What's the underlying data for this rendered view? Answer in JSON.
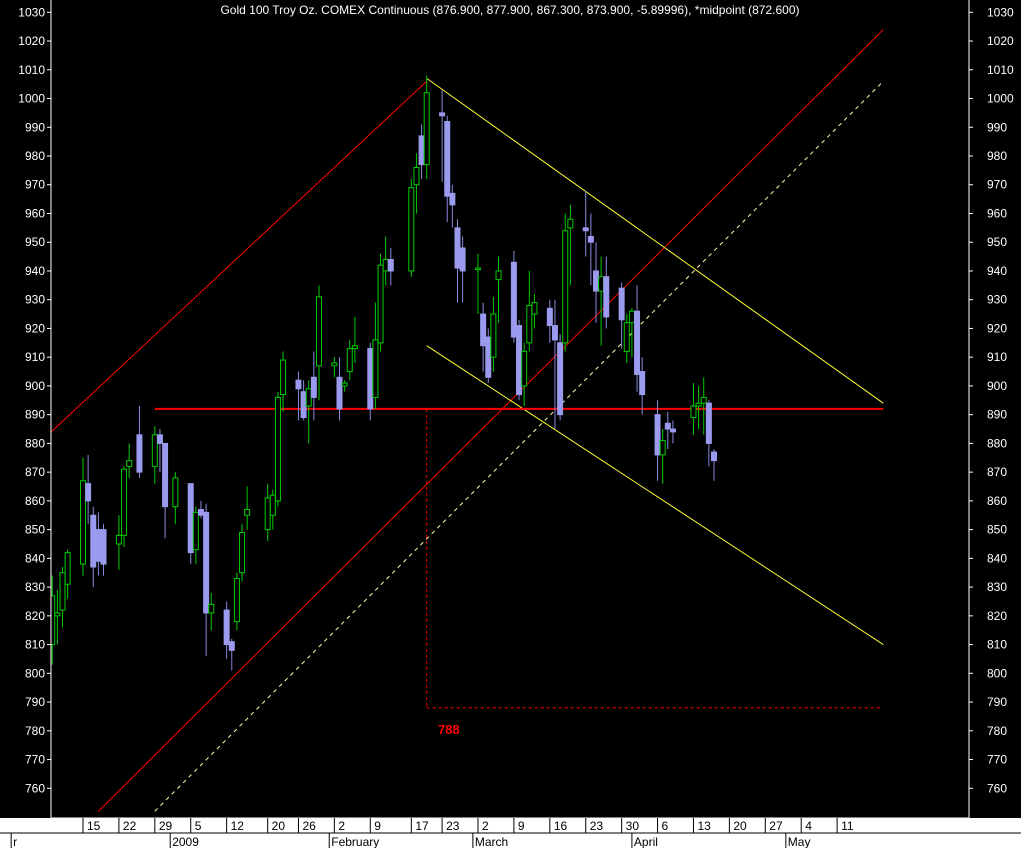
{
  "chart_data": {
    "type": "candlestick",
    "title": "Gold 100 Troy Oz. COMEX Continuous (876.900, 877.900, 867.300, 873.900, -5.89996), *midpoint (872.600)",
    "ylim": [
      752,
      1033
    ],
    "y_ticks": [
      760,
      770,
      780,
      790,
      800,
      810,
      820,
      830,
      840,
      850,
      860,
      870,
      880,
      890,
      900,
      910,
      920,
      930,
      940,
      950,
      960,
      970,
      980,
      990,
      1000,
      1010,
      1020,
      1030
    ],
    "x_day_ticks": [
      {
        "label": "15",
        "date": "2008-12-15"
      },
      {
        "label": "22",
        "date": "2008-12-22"
      },
      {
        "label": "29",
        "date": "2008-12-29"
      },
      {
        "label": "5",
        "date": "2009-01-05"
      },
      {
        "label": "12",
        "date": "2009-01-12"
      },
      {
        "label": "20",
        "date": "2009-01-20"
      },
      {
        "label": "26",
        "date": "2009-01-26"
      },
      {
        "label": "2",
        "date": "2009-02-02"
      },
      {
        "label": "9",
        "date": "2009-02-09"
      },
      {
        "label": "17",
        "date": "2009-02-17"
      },
      {
        "label": "23",
        "date": "2009-02-23"
      },
      {
        "label": "2",
        "date": "2009-03-02"
      },
      {
        "label": "9",
        "date": "2009-03-09"
      },
      {
        "label": "16",
        "date": "2009-03-16"
      },
      {
        "label": "23",
        "date": "2009-03-23"
      },
      {
        "label": "30",
        "date": "2009-03-30"
      },
      {
        "label": "6",
        "date": "2009-04-06"
      },
      {
        "label": "13",
        "date": "2009-04-13"
      },
      {
        "label": "20",
        "date": "2009-04-20"
      },
      {
        "label": "27",
        "date": "2009-04-27"
      },
      {
        "label": "4",
        "date": "2009-05-04"
      },
      {
        "label": "11",
        "date": "2009-05-11"
      }
    ],
    "x_month_labels": [
      {
        "label": "r",
        "date": "2008-12-01"
      },
      {
        "label": "2009",
        "date": "2009-01-01"
      },
      {
        "label": "February",
        "date": "2009-02-01"
      },
      {
        "label": "March",
        "date": "2009-03-01"
      },
      {
        "label": "April",
        "date": "2009-04-01"
      },
      {
        "label": "May",
        "date": "2009-05-01"
      }
    ],
    "candles": [
      {
        "date": "2008-12-08",
        "open": 776,
        "high": 800,
        "low": 775,
        "close": 798
      },
      {
        "date": "2008-12-09",
        "open": 810,
        "high": 834,
        "low": 803,
        "close": 827
      },
      {
        "date": "2008-12-10",
        "open": 820,
        "high": 829,
        "low": 810,
        "close": 821
      },
      {
        "date": "2008-12-11",
        "open": 822,
        "high": 837,
        "low": 816,
        "close": 835
      },
      {
        "date": "2008-12-12",
        "open": 831,
        "high": 843,
        "low": 826,
        "close": 842
      },
      {
        "date": "2008-12-15",
        "open": 838,
        "high": 875,
        "low": 834,
        "close": 867
      },
      {
        "date": "2008-12-16",
        "open": 866,
        "high": 876,
        "low": 852,
        "close": 860
      },
      {
        "date": "2008-12-17",
        "open": 855,
        "high": 858,
        "low": 830,
        "close": 837
      },
      {
        "date": "2008-12-18",
        "open": 850,
        "high": 856,
        "low": 834,
        "close": 839
      },
      {
        "date": "2008-12-19",
        "open": 850,
        "high": 852,
        "low": 834,
        "close": 838
      },
      {
        "date": "2008-12-22",
        "open": 845,
        "high": 855,
        "low": 836,
        "close": 848
      },
      {
        "date": "2008-12-23",
        "open": 848,
        "high": 872,
        "low": 844,
        "close": 871
      },
      {
        "date": "2008-12-24",
        "open": 872,
        "high": 880,
        "low": 868,
        "close": 874
      },
      {
        "date": "2008-12-26",
        "open": 883,
        "high": 893,
        "low": 868,
        "close": 870
      },
      {
        "date": "2008-12-29",
        "open": 872,
        "high": 886,
        "low": 866,
        "close": 883
      },
      {
        "date": "2008-12-30",
        "open": 883,
        "high": 885,
        "low": 870,
        "close": 880
      },
      {
        "date": "2008-12-31",
        "open": 880,
        "high": 880,
        "low": 847,
        "close": 858
      },
      {
        "date": "2009-01-02",
        "open": 858,
        "high": 870,
        "low": 852,
        "close": 868
      },
      {
        "date": "2009-01-05",
        "open": 866,
        "high": 866,
        "low": 838,
        "close": 842
      },
      {
        "date": "2009-01-06",
        "open": 843,
        "high": 858,
        "low": 838,
        "close": 856
      },
      {
        "date": "2009-01-07",
        "open": 857,
        "high": 860,
        "low": 854,
        "close": 855
      },
      {
        "date": "2009-01-08",
        "open": 856,
        "high": 859,
        "low": 806,
        "close": 821
      },
      {
        "date": "2009-01-09",
        "open": 821,
        "high": 828,
        "low": 815,
        "close": 824
      },
      {
        "date": "2009-01-12",
        "open": 822,
        "high": 825,
        "low": 805,
        "close": 810
      },
      {
        "date": "2009-01-13",
        "open": 811,
        "high": 812,
        "low": 801,
        "close": 808
      },
      {
        "date": "2009-01-14",
        "open": 818,
        "high": 835,
        "low": 815,
        "close": 833
      },
      {
        "date": "2009-01-15",
        "open": 835,
        "high": 852,
        "low": 832,
        "close": 849
      },
      {
        "date": "2009-01-16",
        "open": 855,
        "high": 865,
        "low": 850,
        "close": 857
      },
      {
        "date": "2009-01-20",
        "open": 850,
        "high": 866,
        "low": 846,
        "close": 861
      },
      {
        "date": "2009-01-21",
        "open": 855,
        "high": 864,
        "low": 850,
        "close": 862
      },
      {
        "date": "2009-01-22",
        "open": 860,
        "high": 898,
        "low": 858,
        "close": 896
      },
      {
        "date": "2009-01-23",
        "open": 897,
        "high": 912,
        "low": 891,
        "close": 909
      },
      {
        "date": "2009-01-26",
        "open": 902,
        "high": 905,
        "low": 888,
        "close": 899
      },
      {
        "date": "2009-01-27",
        "open": 898,
        "high": 902,
        "low": 888,
        "close": 889
      },
      {
        "date": "2009-01-28",
        "open": 893,
        "high": 902,
        "low": 880,
        "close": 899
      },
      {
        "date": "2009-01-29",
        "open": 903,
        "high": 912,
        "low": 888,
        "close": 896
      },
      {
        "date": "2009-01-30",
        "open": 907,
        "high": 935,
        "low": 895,
        "close": 931
      },
      {
        "date": "2009-02-02",
        "open": 907,
        "high": 910,
        "low": 903,
        "close": 908
      },
      {
        "date": "2009-02-03",
        "open": 903,
        "high": 910,
        "low": 888,
        "close": 892
      },
      {
        "date": "2009-02-04",
        "open": 900,
        "high": 902,
        "low": 898,
        "close": 901
      },
      {
        "date": "2009-02-05",
        "open": 905,
        "high": 916,
        "low": 902,
        "close": 913
      },
      {
        "date": "2009-02-06",
        "open": 913,
        "high": 924,
        "low": 908,
        "close": 914
      },
      {
        "date": "2009-02-09",
        "open": 913,
        "high": 915,
        "low": 888,
        "close": 892
      },
      {
        "date": "2009-02-10",
        "open": 896,
        "high": 929,
        "low": 892,
        "close": 916
      },
      {
        "date": "2009-02-11",
        "open": 915,
        "high": 946,
        "low": 912,
        "close": 942
      },
      {
        "date": "2009-02-12",
        "open": 940,
        "high": 952,
        "low": 935,
        "close": 944
      },
      {
        "date": "2009-02-13",
        "open": 944,
        "high": 948,
        "low": 935,
        "close": 940
      },
      {
        "date": "2009-02-17",
        "open": 940,
        "high": 972,
        "low": 938,
        "close": 969
      },
      {
        "date": "2009-02-18",
        "open": 970,
        "high": 981,
        "low": 960,
        "close": 976
      },
      {
        "date": "2009-02-19",
        "open": 987,
        "high": 991,
        "low": 972,
        "close": 977
      },
      {
        "date": "2009-02-20",
        "open": 977,
        "high": 1008,
        "low": 972,
        "close": 1002
      },
      {
        "date": "2009-02-23",
        "open": 995,
        "high": 1003,
        "low": 971,
        "close": 994
      },
      {
        "date": "2009-02-24",
        "open": 992,
        "high": 994,
        "low": 957,
        "close": 966
      },
      {
        "date": "2009-02-25",
        "open": 967,
        "high": 970,
        "low": 955,
        "close": 963
      },
      {
        "date": "2009-02-26",
        "open": 955,
        "high": 958,
        "low": 929,
        "close": 941
      },
      {
        "date": "2009-02-27",
        "open": 948,
        "high": 952,
        "low": 929,
        "close": 940
      },
      {
        "date": "2009-03-02",
        "open": 941,
        "high": 946,
        "low": 925,
        "close": 941
      },
      {
        "date": "2009-03-03",
        "open": 925,
        "high": 929,
        "low": 905,
        "close": 914
      },
      {
        "date": "2009-03-04",
        "open": 917,
        "high": 920,
        "low": 901,
        "close": 903
      },
      {
        "date": "2009-03-05",
        "open": 910,
        "high": 931,
        "low": 905,
        "close": 925
      },
      {
        "date": "2009-03-06",
        "open": 937,
        "high": 945,
        "low": 922,
        "close": 940
      },
      {
        "date": "2009-03-09",
        "open": 943,
        "high": 947,
        "low": 915,
        "close": 917
      },
      {
        "date": "2009-03-10",
        "open": 921,
        "high": 923,
        "low": 895,
        "close": 897
      },
      {
        "date": "2009-03-11",
        "open": 900,
        "high": 915,
        "low": 893,
        "close": 912
      },
      {
        "date": "2009-03-12",
        "open": 915,
        "high": 940,
        "low": 912,
        "close": 928
      },
      {
        "date": "2009-03-13",
        "open": 925,
        "high": 932,
        "low": 920,
        "close": 929
      },
      {
        "date": "2009-03-16",
        "open": 927,
        "high": 930,
        "low": 915,
        "close": 921
      },
      {
        "date": "2009-03-17",
        "open": 921,
        "high": 930,
        "low": 885,
        "close": 916
      },
      {
        "date": "2009-03-18",
        "open": 915,
        "high": 918,
        "low": 888,
        "close": 890
      },
      {
        "date": "2009-03-19",
        "open": 915,
        "high": 960,
        "low": 912,
        "close": 954
      },
      {
        "date": "2009-03-20",
        "open": 955,
        "high": 963,
        "low": 935,
        "close": 958
      },
      {
        "date": "2009-03-23",
        "open": 955,
        "high": 968,
        "low": 945,
        "close": 954
      },
      {
        "date": "2009-03-24",
        "open": 952,
        "high": 960,
        "low": 935,
        "close": 950
      },
      {
        "date": "2009-03-25",
        "open": 940,
        "high": 950,
        "low": 922,
        "close": 933
      },
      {
        "date": "2009-03-26",
        "open": 933,
        "high": 945,
        "low": 914,
        "close": 938
      },
      {
        "date": "2009-03-27",
        "open": 938,
        "high": 945,
        "low": 920,
        "close": 924
      },
      {
        "date": "2009-03-30",
        "open": 934,
        "high": 936,
        "low": 913,
        "close": 923
      },
      {
        "date": "2009-03-31",
        "open": 912,
        "high": 925,
        "low": 908,
        "close": 922
      },
      {
        "date": "2009-04-01",
        "open": 922,
        "high": 927,
        "low": 910,
        "close": 926
      },
      {
        "date": "2009-04-02",
        "open": 926,
        "high": 935,
        "low": 898,
        "close": 904
      },
      {
        "date": "2009-04-03",
        "open": 905,
        "high": 910,
        "low": 890,
        "close": 897
      },
      {
        "date": "2009-04-06",
        "open": 890,
        "high": 895,
        "low": 867,
        "close": 876
      },
      {
        "date": "2009-04-07",
        "open": 876,
        "high": 885,
        "low": 866,
        "close": 881
      },
      {
        "date": "2009-04-08",
        "open": 887,
        "high": 891,
        "low": 878,
        "close": 885
      },
      {
        "date": "2009-04-09",
        "open": 885,
        "high": 888,
        "low": 880,
        "close": 884
      },
      {
        "date": "2009-04-13",
        "open": 889,
        "high": 901,
        "low": 883,
        "close": 893
      },
      {
        "date": "2009-04-14",
        "open": 893,
        "high": 900,
        "low": 885,
        "close": 894
      },
      {
        "date": "2009-04-15",
        "open": 894,
        "high": 903,
        "low": 883,
        "close": 896
      },
      {
        "date": "2009-04-16",
        "open": 894,
        "high": 895,
        "low": 872,
        "close": 880
      },
      {
        "date": "2009-04-17",
        "open": 877,
        "high": 878,
        "low": 867,
        "close": 874
      }
    ],
    "trendlines": [
      {
        "style": "red-solid",
        "p1": {
          "date": "2008-12-01",
          "y": 871
        },
        "p2": {
          "date": "2009-02-20",
          "y": 1006
        }
      },
      {
        "style": "red-solid",
        "p1": {
          "date": "2008-12-18",
          "y": 752
        },
        "p2": {
          "date": "2009-05-20",
          "y": 1024
        }
      },
      {
        "style": "yellow-dashed",
        "p1": {
          "date": "2008-12-29",
          "y": 752
        },
        "p2": {
          "date": "2009-05-20",
          "y": 1006
        }
      },
      {
        "style": "yellow-solid",
        "p1": {
          "date": "2009-02-20",
          "y": 1007
        },
        "p2": {
          "date": "2009-05-20",
          "y": 894
        }
      },
      {
        "style": "yellow-solid",
        "p1": {
          "date": "2009-02-20",
          "y": 914
        },
        "p2": {
          "date": "2009-05-20",
          "y": 810
        }
      },
      {
        "style": "red-solid-thick",
        "p1": {
          "date": "2008-12-29",
          "y": 892
        },
        "p2": {
          "date": "2009-05-20",
          "y": 892
        }
      },
      {
        "style": "red-dashed",
        "p1": {
          "date": "2009-02-20",
          "y": 892
        },
        "p2": {
          "date": "2009-02-20",
          "y": 788
        }
      },
      {
        "style": "red-dashed",
        "p1": {
          "date": "2009-02-20",
          "y": 788
        },
        "p2": {
          "date": "2009-05-20",
          "y": 788
        }
      }
    ],
    "annotations": [
      {
        "text": "788",
        "date": "2009-02-22",
        "y": 788
      }
    ]
  }
}
